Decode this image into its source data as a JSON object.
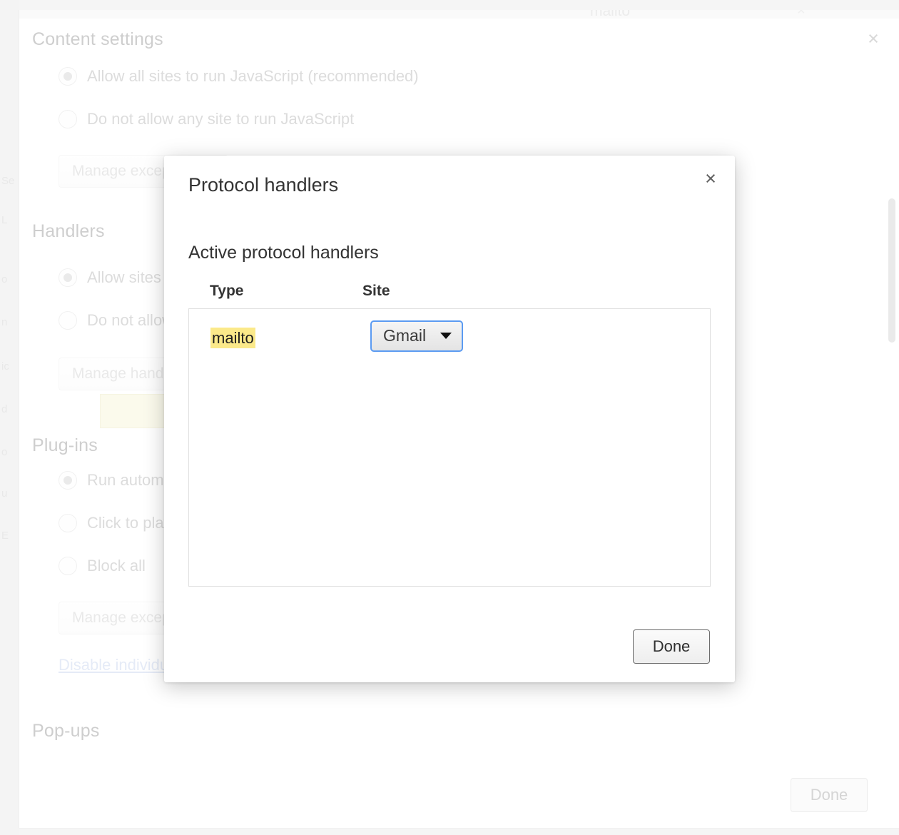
{
  "background_page": {
    "top_cutoff_text": "mailto",
    "close_icon": "×",
    "sections": [
      {
        "title": "Content settings",
        "options": [
          {
            "label": "Allow all sites to run JavaScript (recommended)",
            "selected": true
          },
          {
            "label": "Do not allow any site to run JavaScript",
            "selected": false
          }
        ],
        "button": "Manage exceptions..."
      },
      {
        "title": "Handlers",
        "options": [
          {
            "label": "Allow sites to ask to become default handlers for protocols (recommended)",
            "selected": true
          },
          {
            "label": "Do not allow any site to handle protocols",
            "selected": false
          }
        ],
        "button": "Manage handlers..."
      },
      {
        "title": "Plug-ins",
        "options": [
          {
            "label": "Run automatically (recommended)",
            "selected": true
          },
          {
            "label": "Click to play",
            "selected": false
          },
          {
            "label": "Block all",
            "selected": false
          }
        ],
        "button": "Manage exceptions...",
        "link": "Disable individual plug-ins..."
      },
      {
        "title": "Pop-ups",
        "options": [],
        "button": ""
      }
    ],
    "done_button": "Done",
    "tooltip": {
      "text": "mailto"
    },
    "ghost_sidebar_items": [
      "Se",
      "L",
      "o",
      "n",
      "ic",
      "d",
      "o",
      "u",
      "E"
    ]
  },
  "modal": {
    "title": "Protocol handlers",
    "close_icon": "×",
    "subtitle": "Active protocol handlers",
    "columns": {
      "type": "Type",
      "site": "Site"
    },
    "rows": [
      {
        "type": "mailto",
        "site": "Gmail",
        "site_caret": "▼",
        "type_highlighted": true
      }
    ],
    "done_button": "Done"
  },
  "colors": {
    "highlight_yellow": "#fbe98a",
    "focus_blue": "#5b9bf2",
    "tooltip_yellow": "#f7f6dd",
    "link_blue": "#a9bce4"
  }
}
